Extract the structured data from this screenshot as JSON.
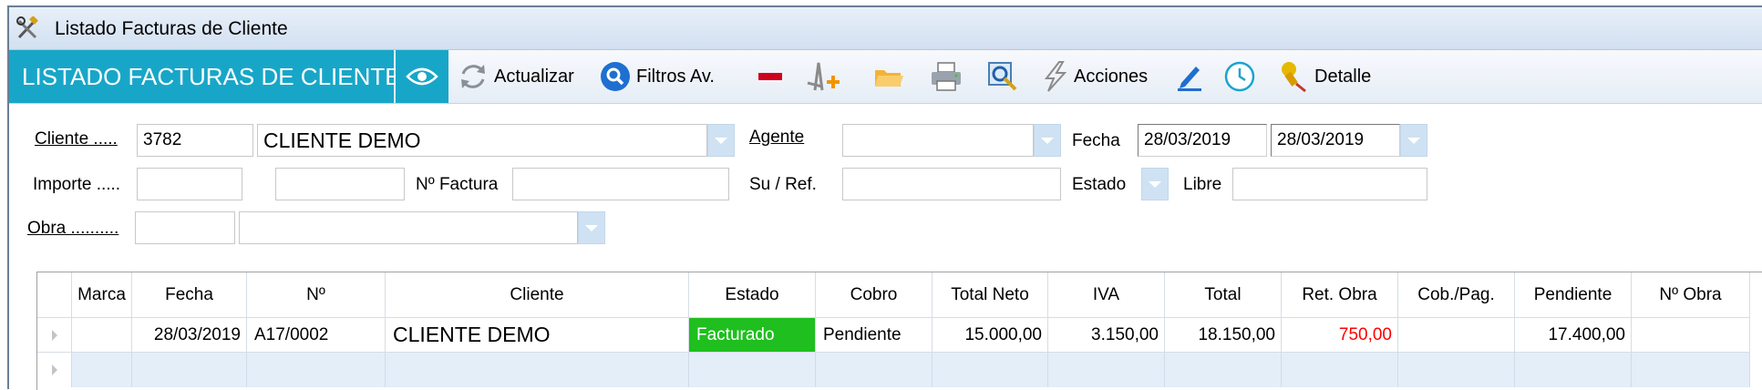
{
  "window": {
    "title": "Listado Facturas de Cliente",
    "icon": "tools-icon"
  },
  "toolbar": {
    "brand": "LISTADO FACTURAS DE CLIENTE",
    "refresh_label": "Actualizar",
    "filters_label": "Filtros Av.",
    "actions_label": "Acciones",
    "detail_label": "Detalle",
    "icons": [
      "eye-icon",
      "refresh-icon",
      "search-icon",
      "minus-icon",
      "new-document-icon",
      "folder-icon",
      "printer-icon",
      "preview-icon",
      "lightning-icon",
      "pencil-icon",
      "clock-icon",
      "pin-icon"
    ]
  },
  "filters": {
    "cliente_label": "Cliente .....",
    "cliente_code": "3782",
    "cliente_name": "CLIENTE DEMO",
    "agente_label": "Agente",
    "agente_value": "",
    "fecha_label": "Fecha",
    "fecha_from": "28/03/2019",
    "fecha_to": "28/03/2019",
    "importe_label": "Importe .....",
    "importe_from": "",
    "importe_to": "",
    "nfactura_label": "Nº Factura",
    "nfactura_value": "",
    "suref_label": "Su / Ref.",
    "suref_value": "",
    "estado_label": "Estado",
    "libre_label": "Libre",
    "libre_value": "",
    "obra_label": "Obra ..........",
    "obra_code": "",
    "obra_name": ""
  },
  "table": {
    "columns": [
      "Marca",
      "Fecha",
      "Nº",
      "Cliente",
      "Estado",
      "Cobro",
      "Total Neto",
      "IVA",
      "Total",
      "Ret. Obra",
      "Cob./Pag.",
      "Pendiente",
      "Nº Obra"
    ],
    "rows": [
      [
        "",
        "28/03/2019",
        "A17/0002",
        "CLIENTE DEMO",
        "Facturado",
        "Pendiente",
        "15.000,00",
        "3.150,00",
        "18.150,00",
        "750,00",
        "",
        "17.400,00",
        ""
      ]
    ],
    "colors": {
      "estado_bg": "#1fbf1f",
      "ret_obra_text": "#ff0000"
    }
  }
}
